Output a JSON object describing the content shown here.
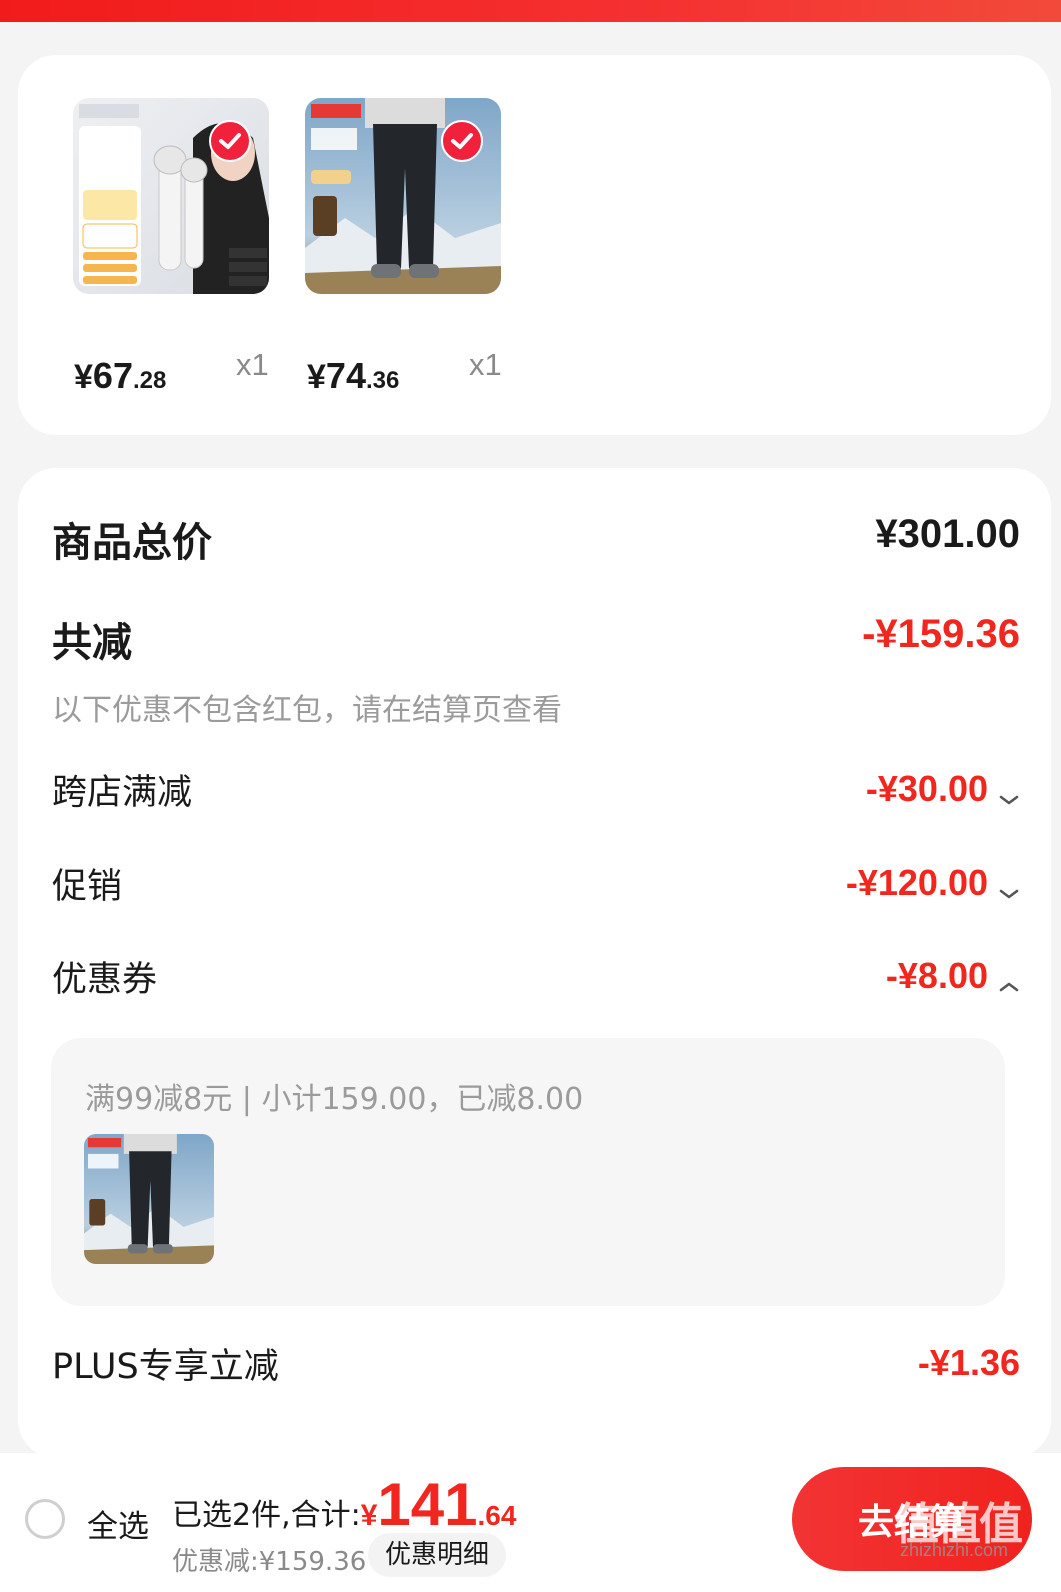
{
  "products": [
    {
      "price_yen": "¥",
      "price_int": "67",
      "price_dec": ".28",
      "qty": "x1",
      "image_icon": "facial-device-product-image"
    },
    {
      "price_yen": "¥",
      "price_int": "74",
      "price_dec": ".36",
      "qty": "x1",
      "image_icon": "down-pants-product-image"
    }
  ],
  "summary": {
    "total_label": "商品总价",
    "total_value": "¥301.00",
    "reduce_label": "共减",
    "reduce_value": "-¥159.36",
    "note": "以下优惠不包含红包，请在结算页查看",
    "cross_store_label": "跨店满减",
    "cross_store_value": "-¥30.00",
    "promo_label": "促销",
    "promo_value": "-¥120.00",
    "coupon_label": "优惠券",
    "coupon_value": "-¥8.00",
    "coupon_detail": "满99减8元 | 小计159.00，已减8.00",
    "plus_label": "PLUS专享立减",
    "plus_value": "-¥1.36"
  },
  "bottom": {
    "select_all": "全选",
    "selected_text": "已选2件,合计:",
    "total_yen": "¥",
    "total_int": "141",
    "total_dec": ".64",
    "discount_text": "优惠减:¥159.36",
    "detail_button": "优惠明细",
    "checkout_button": "去结算"
  },
  "watermark": {
    "text": "值值值",
    "sub": "zhizhizhi.com"
  },
  "colors": {
    "accent_red": "#f0261f",
    "top_bar": "#f21b1b",
    "check_red": "#f2213b"
  }
}
